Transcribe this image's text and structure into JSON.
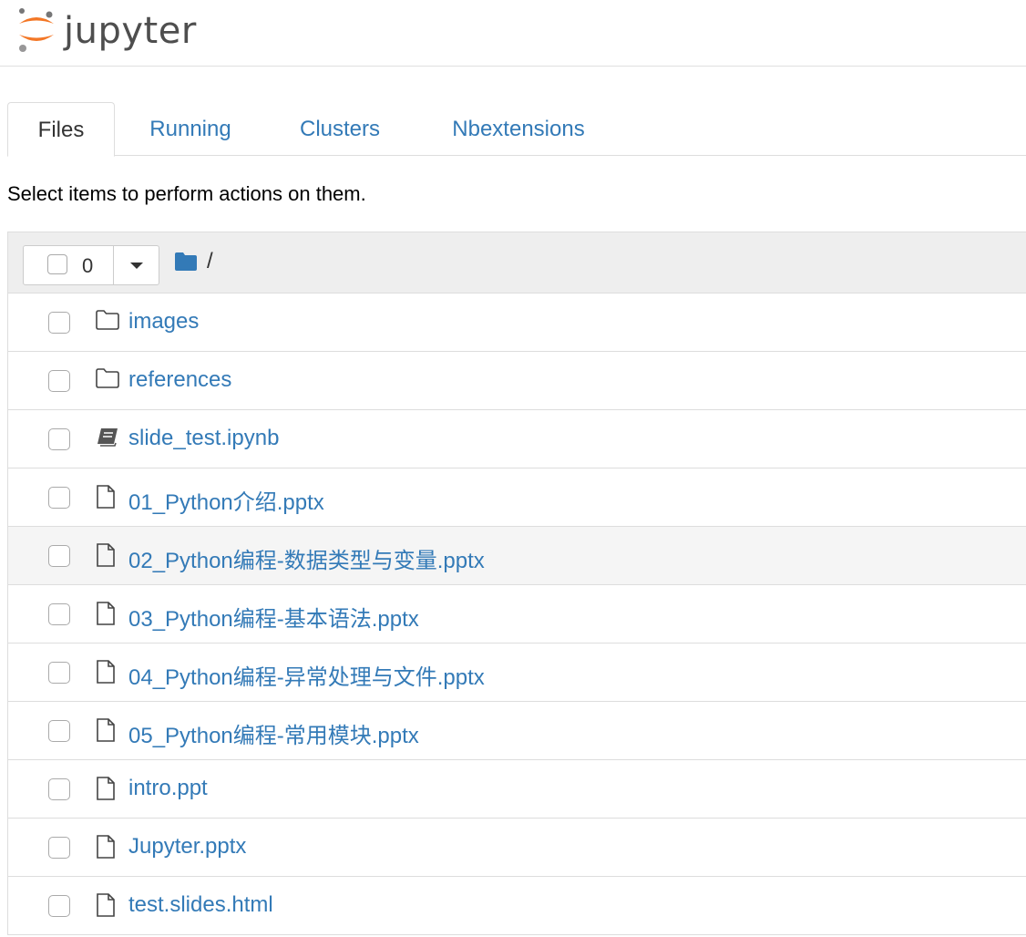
{
  "app": {
    "logo_text": "jupyter"
  },
  "tabs": [
    {
      "label": "Files",
      "active": true
    },
    {
      "label": "Running",
      "active": false
    },
    {
      "label": "Clusters",
      "active": false
    },
    {
      "label": "Nbextensions",
      "active": false
    }
  ],
  "hint": "Select items to perform actions on them.",
  "toolbar": {
    "selected_count": "0",
    "breadcrumb_path": "/"
  },
  "files": [
    {
      "name": "images",
      "icon": "folder-icon"
    },
    {
      "name": "references",
      "icon": "folder-icon"
    },
    {
      "name": "slide_test.ipynb",
      "icon": "notebook-icon"
    },
    {
      "name": "01_Python介绍.pptx",
      "icon": "file-icon"
    },
    {
      "name": "02_Python编程-数据类型与变量.pptx",
      "icon": "file-icon"
    },
    {
      "name": "03_Python编程-基本语法.pptx",
      "icon": "file-icon"
    },
    {
      "name": "04_Python编程-异常处理与文件.pptx",
      "icon": "file-icon"
    },
    {
      "name": "05_Python编程-常用模块.pptx",
      "icon": "file-icon"
    },
    {
      "name": "intro.ppt",
      "icon": "file-icon"
    },
    {
      "name": "Jupyter.pptx",
      "icon": "file-icon"
    },
    {
      "name": "test.slides.html",
      "icon": "file-icon"
    }
  ],
  "colors": {
    "link": "#337ab7",
    "logo_orange": "#f37726",
    "header_bg": "#eeeeee"
  }
}
